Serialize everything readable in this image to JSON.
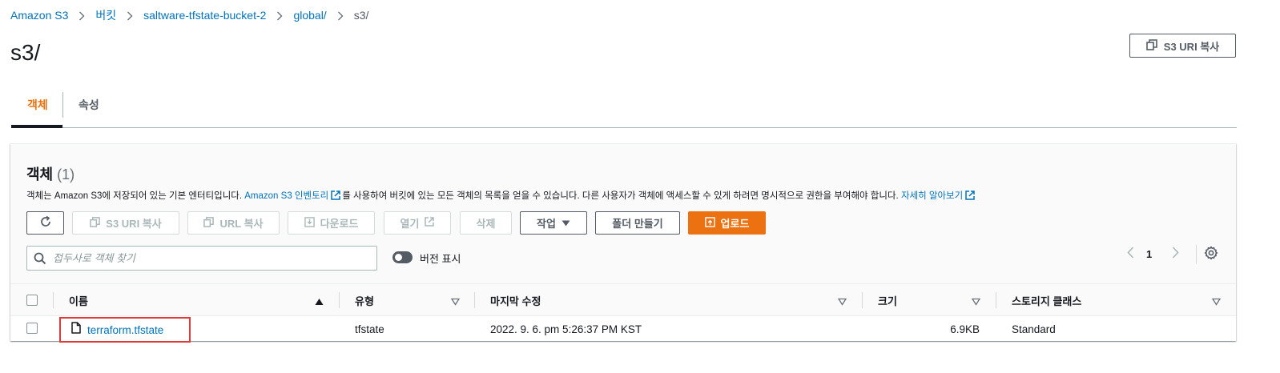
{
  "breadcrumb": {
    "items": [
      "Amazon S3",
      "버킷",
      "saltware-tfstate-bucket-2",
      "global/",
      "s3/"
    ]
  },
  "page": {
    "title": "s3/",
    "copy_uri_label": "S3 URI 복사"
  },
  "tabs": [
    {
      "label": "객체",
      "active": true
    },
    {
      "label": "속성",
      "active": false
    }
  ],
  "objects_panel": {
    "title": "객체",
    "count": "(1)",
    "desc_part1": "객체는 Amazon S3에 저장되어 있는 기본 엔터티입니다.",
    "desc_link1": "Amazon S3 인벤토리",
    "desc_part2": "를 사용하여 버킷에 있는 모든 객체의 목록을 얻을 수 있습니다. 다른 사용자가 객체에 액세스할 수 있게 하려면 명시적으로 권한을 부여해야 합니다.",
    "desc_link2": "자세히 알아보기"
  },
  "toolbar": {
    "copy_s3_uri": "S3 URI 복사",
    "copy_url": "URL 복사",
    "download": "다운로드",
    "open": "열기",
    "delete": "삭제",
    "actions": "작업",
    "create_folder": "폴더 만들기",
    "upload": "업로드"
  },
  "search": {
    "placeholder": "접두사로 객체 찾기"
  },
  "version_toggle": {
    "label": "버전 표시",
    "on": false
  },
  "pagination": {
    "current_page": "1"
  },
  "table": {
    "columns": [
      "이름",
      "유형",
      "마지막 수정",
      "크기",
      "스토리지 클래스"
    ],
    "rows": [
      {
        "name": "terraform.tfstate",
        "type": "tfstate",
        "modified": "2022. 9. 6. pm 5:26:37 PM KST",
        "size": "6.9KB",
        "storage_class": "Standard"
      }
    ]
  },
  "colors": {
    "accent": "#ec7211",
    "link": "#0073bb",
    "text": "#16191f",
    "highlight_border": "#df3a3a"
  }
}
